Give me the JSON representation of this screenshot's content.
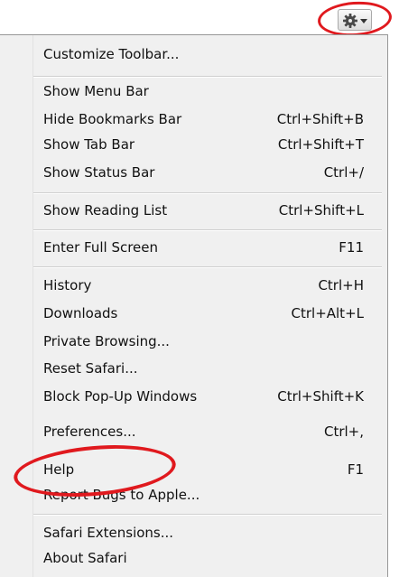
{
  "colors": {
    "menu_background": "#f0f0f0",
    "highlight_red": "#e0191e"
  },
  "toolbar": {
    "gear_icon": "gear-icon",
    "dropdown_icon": "chevron-down-icon"
  },
  "menu": {
    "items": [
      {
        "label": "Customize Toolbar...",
        "shortcut": ""
      },
      {
        "label": "Show Menu Bar",
        "shortcut": ""
      },
      {
        "label": "Hide Bookmarks Bar",
        "shortcut": "Ctrl+Shift+B"
      },
      {
        "label": "Show Tab Bar",
        "shortcut": "Ctrl+Shift+T"
      },
      {
        "label": "Show Status Bar",
        "shortcut": "Ctrl+/"
      },
      {
        "label": "Show Reading List",
        "shortcut": "Ctrl+Shift+L"
      },
      {
        "label": "Enter Full Screen",
        "shortcut": "F11"
      },
      {
        "label": "History",
        "shortcut": "Ctrl+H"
      },
      {
        "label": "Downloads",
        "shortcut": "Ctrl+Alt+L"
      },
      {
        "label": "Private Browsing...",
        "shortcut": ""
      },
      {
        "label": "Reset Safari...",
        "shortcut": ""
      },
      {
        "label": "Block Pop-Up Windows",
        "shortcut": "Ctrl+Shift+K"
      },
      {
        "label": "Preferences...",
        "shortcut": "Ctrl+,"
      },
      {
        "label": "Help",
        "shortcut": "F1"
      },
      {
        "label": "Report Bugs to Apple...",
        "shortcut": ""
      },
      {
        "label": "Safari Extensions...",
        "shortcut": ""
      },
      {
        "label": "About Safari",
        "shortcut": ""
      }
    ]
  }
}
